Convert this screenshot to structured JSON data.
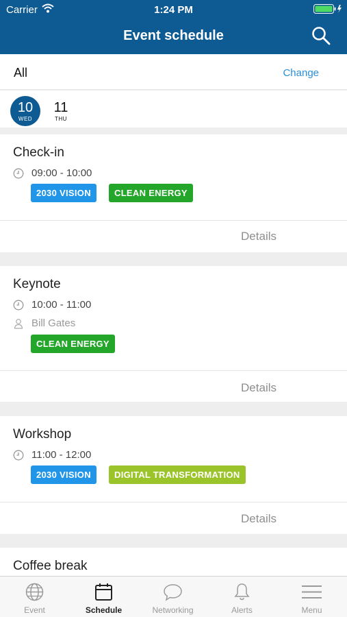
{
  "status_bar": {
    "carrier": "Carrier",
    "time": "1:24 PM"
  },
  "nav": {
    "title": "Event schedule",
    "search_icon": "search-icon"
  },
  "filter": {
    "label": "All",
    "action": "Change"
  },
  "days": [
    {
      "number": "10",
      "weekday": "WED",
      "selected": true
    },
    {
      "number": "11",
      "weekday": "THU",
      "selected": false
    }
  ],
  "sessions": [
    {
      "title": "Check-in",
      "time": "09:00 - 10:00",
      "speaker": null,
      "tags": [
        {
          "label": "2030 VISION",
          "color": "#2196e8"
        },
        {
          "label": "CLEAN ENERGY",
          "color": "#23a629"
        }
      ],
      "details_label": "Details"
    },
    {
      "title": "Keynote",
      "time": "10:00 - 11:00",
      "speaker": "Bill Gates",
      "tags": [
        {
          "label": "CLEAN ENERGY",
          "color": "#23a629"
        }
      ],
      "details_label": "Details"
    },
    {
      "title": "Workshop",
      "time": "11:00 - 12:00",
      "speaker": null,
      "tags": [
        {
          "label": "2030 VISION",
          "color": "#2196e8"
        },
        {
          "label": "DIGITAL TRANSFORMATION",
          "color": "#9bc42a"
        }
      ],
      "details_label": "Details"
    },
    {
      "title": "Coffee break"
    }
  ],
  "tabbar": [
    {
      "label": "Event",
      "icon": "globe-icon",
      "active": false
    },
    {
      "label": "Schedule",
      "icon": "calendar-icon",
      "active": true
    },
    {
      "label": "Networking",
      "icon": "chat-bubble-icon",
      "active": false
    },
    {
      "label": "Alerts",
      "icon": "bell-icon",
      "active": false
    },
    {
      "label": "Menu",
      "icon": "hamburger-menu-icon",
      "active": false
    }
  ],
  "colors": {
    "header": "#0e5a93",
    "link": "#2a8fd6"
  }
}
